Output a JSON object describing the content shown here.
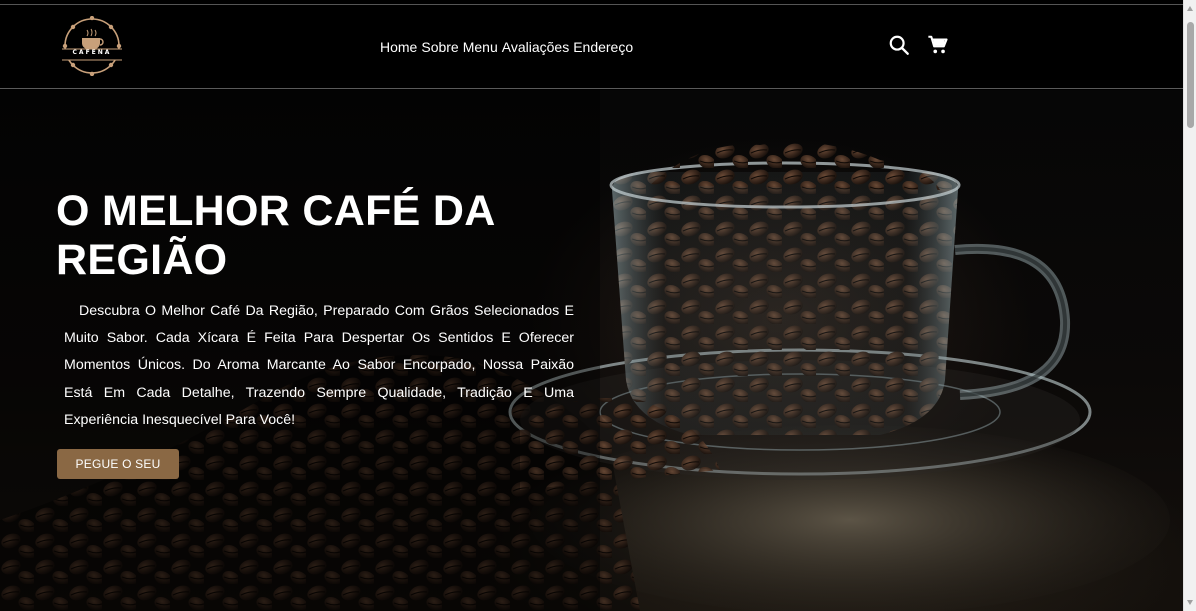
{
  "header": {
    "logo_text": "CAFENA",
    "nav": [
      {
        "label": "Home"
      },
      {
        "label": "Sobre"
      },
      {
        "label": "Menu"
      },
      {
        "label": "Avaliações"
      },
      {
        "label": "Endereço"
      }
    ],
    "icons": [
      "search-icon",
      "cart-icon"
    ]
  },
  "hero": {
    "title": "O MELHOR CAFÉ DA REGIÃO",
    "text": "Descubra O Melhor Café Da Região, Preparado Com Grãos Selecionados E Muito Sabor. Cada Xícara É Feita Para Despertar Os Sentidos E Oferecer Momentos Únicos. Do Aroma Marcante Ao Sabor Encorpado, Nossa Paixão Está Em Cada Detalhe, Trazendo Sempre Qualidade, Tradição E Uma Experiência Inesquecível Para Você!",
    "cta_label": "PEGUE O SEU"
  },
  "colors": {
    "background": "#000000",
    "accent": "#8a6844",
    "text": "#ffffff"
  }
}
